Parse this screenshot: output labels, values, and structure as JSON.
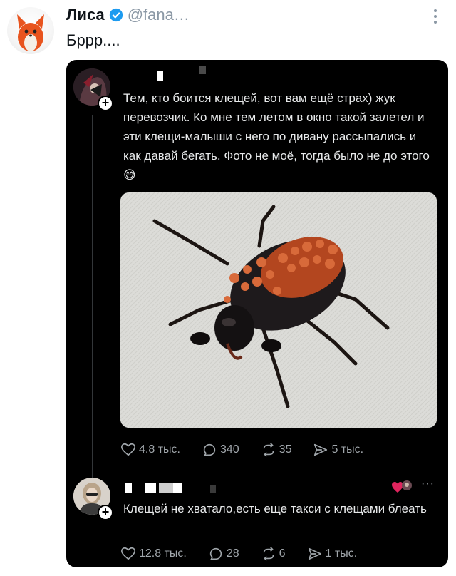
{
  "outer": {
    "name": "Лиса",
    "handle": "@fana…",
    "text": "Бррр...."
  },
  "post": {
    "text": "Тем, кто боится клещей, вот вам ещё страх) жук перевозчик. Ко мне тем летом в окно такой залетел и эти клещи-малыши с него по дивану рассыпались и как давай бегать. Фото не моё, тогда было не до этого😅",
    "stats": {
      "likes": "4.8 тыс.",
      "replies": "340",
      "reposts": "35",
      "views": "5 тыс."
    }
  },
  "reply": {
    "text": "Клещей не хватало,есть еще такси с клещами блеать",
    "more": "···",
    "stats": {
      "likes": "12.8 тыс.",
      "replies": "28",
      "reposts": "6",
      "views": "1 тыс."
    }
  },
  "icons": {
    "verified": "verified-badge-icon",
    "like": "heart-icon",
    "reply": "comment-icon",
    "repost": "repost-icon",
    "views": "send-icon"
  },
  "colors": {
    "verified": "#1d9bf0",
    "card_bg": "#000000",
    "muted": "#a0a6ab",
    "text_dark": "#e7e9ea"
  }
}
